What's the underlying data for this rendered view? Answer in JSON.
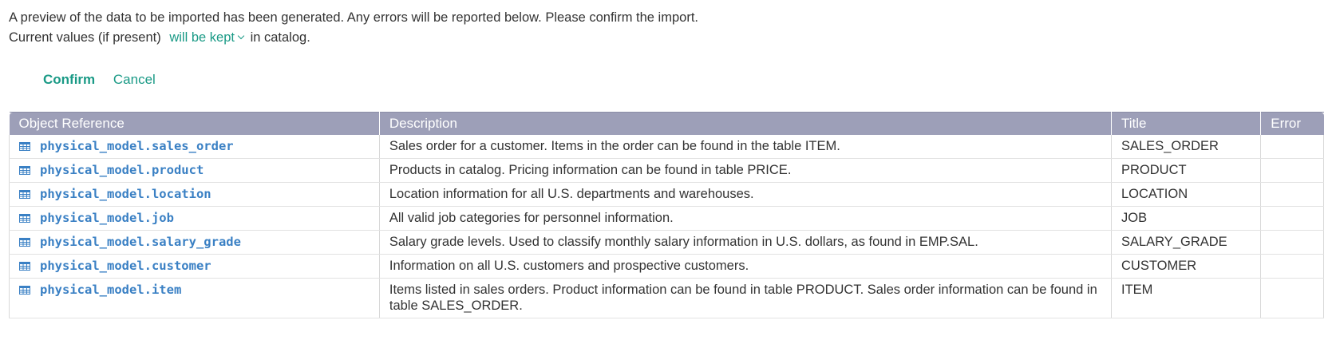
{
  "intro": {
    "line1": "A preview of the data to be imported has been generated. Any errors will be reported below. Please confirm the import.",
    "line2_prefix": "Current values (if present)",
    "keep_option": "will be kept",
    "line2_suffix": "in catalog."
  },
  "actions": {
    "confirm": "Confirm",
    "cancel": "Cancel"
  },
  "table": {
    "headers": {
      "ref": "Object Reference",
      "description": "Description",
      "title": "Title",
      "error": "Error"
    },
    "rows": [
      {
        "ref": "physical_model.sales_order",
        "description": "Sales order for a customer. Items in the order can be found in the table ITEM.",
        "title": "SALES_ORDER",
        "error": ""
      },
      {
        "ref": "physical_model.product",
        "description": "Products in catalog. Pricing information can be found in table PRICE.",
        "title": "PRODUCT",
        "error": ""
      },
      {
        "ref": "physical_model.location",
        "description": "Location information for all U.S. departments and warehouses.",
        "title": "LOCATION",
        "error": ""
      },
      {
        "ref": "physical_model.job",
        "description": "All valid job categories for personnel information.",
        "title": "JOB",
        "error": ""
      },
      {
        "ref": "physical_model.salary_grade",
        "description": "Salary grade levels. Used to classify monthly salary information in U.S. dollars, as found in EMP.SAL.",
        "title": "SALARY_GRADE",
        "error": ""
      },
      {
        "ref": "physical_model.customer",
        "description": "Information on all U.S. customers and prospective customers.",
        "title": "CUSTOMER",
        "error": ""
      },
      {
        "ref": "physical_model.item",
        "description": "Items listed in sales orders. Product information can be found in table PRODUCT. Sales order information can be found in table SALES_ORDER.",
        "title": "ITEM",
        "error": ""
      }
    ]
  },
  "colors": {
    "accent": "#1a9a86",
    "link": "#3a80c4",
    "header_bg": "#9d9fb8"
  },
  "icons": {
    "row_icon": "table-icon",
    "dropdown_icon": "chevron-down-icon"
  }
}
